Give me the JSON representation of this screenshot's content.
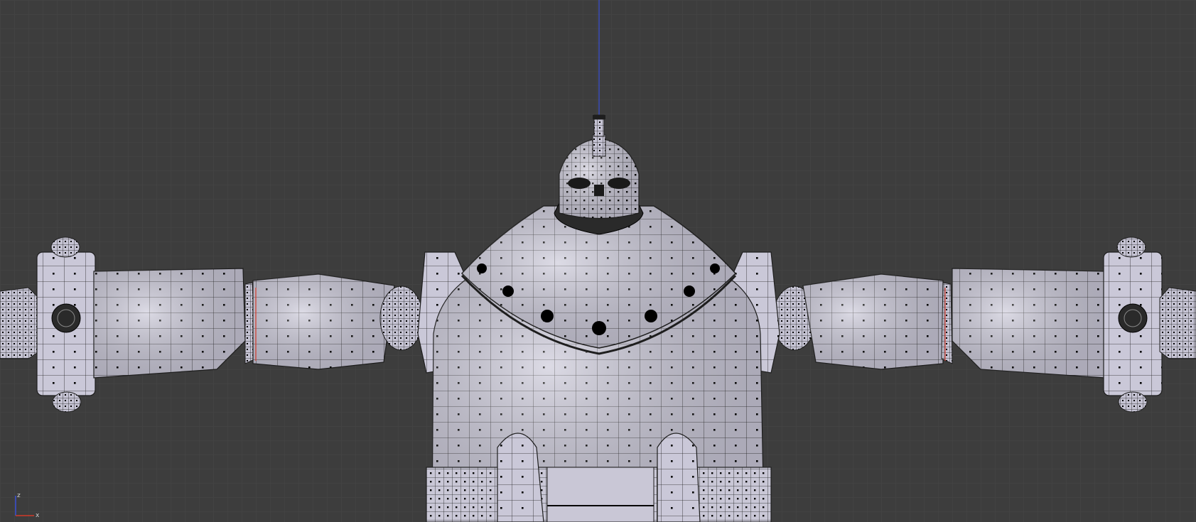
{
  "viewport": {
    "background": "#3d3d3d",
    "grid_color": "#474747",
    "mesh_face": "#c9c7d6",
    "mesh_edge": "#1e1e1e",
    "vertex_color": "#000000",
    "vertical_axis_color": "#3a4fd6",
    "seam_color": "#d23a2a"
  },
  "axis_gizmo": {
    "x_label": "x",
    "z_label": "z",
    "x_color": "#d23a2a",
    "z_color": "#3a4fd6"
  }
}
